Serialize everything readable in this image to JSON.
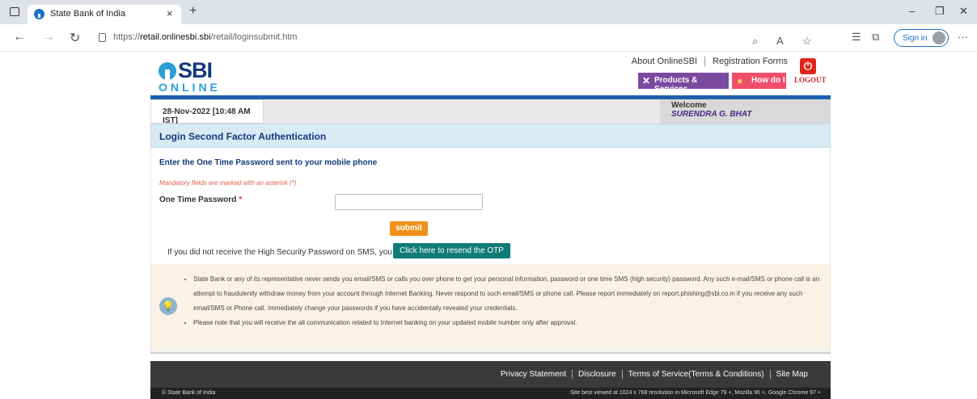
{
  "browser": {
    "tab_title": "State Bank of India",
    "tab_close": "×",
    "new_tab": "+",
    "url_prefix": "https://",
    "url_domain": "retail.onlinesbi.sbi",
    "url_path": "/retail/loginsubmit.htm",
    "sign_in": "Sign in",
    "minimize": "–",
    "maximize": "❐",
    "close": "✕",
    "back": "←",
    "forward": "→",
    "refresh": "↻",
    "more": "···"
  },
  "header": {
    "logo_text": "SBI",
    "logo_sub": "ONLINE",
    "about": "About OnlineSBI",
    "registration": "Registration Forms",
    "products": "Products & Services",
    "howdo": "How do I",
    "logout": "LOGOUT"
  },
  "infobar": {
    "date": "28-Nov-2022 [10:48 AM IST]",
    "welcome_label": "Welcome",
    "username": "SURENDRA G. BHAT"
  },
  "form": {
    "section_title": "Login Second Factor Authentication",
    "instruction": "Enter the One Time Password sent to your mobile phone",
    "mandatory_note": "Mandatory fields are marked with an asterisk (*)",
    "otp_label": "One Time Password",
    "asterisk": "*",
    "otp_value": "",
    "submit": "submit",
    "resend_text": "If you did not receive the High Security Password on SMS, you can",
    "resend_button": "Click here to resend the OTP"
  },
  "notice": {
    "items": [
      "State Bank or any of its representative never sends you email/SMS or calls you over phone to get your personal information, password or one time SMS (high security) password. Any such e-mail/SMS or phone call is an attempt to fraudulently withdraw money from your account through Internet Banking. Never respond to such email/SMS or phone call. Please report immediately on report.phishing@sbi.co.in if you receive any such email/SMS or Phone call. Immediately change your passwords if you have accidentally revealed your credentials.",
      "Please note that you will receive the all communication related to Internet banking on your updated mobile number only after approval."
    ]
  },
  "footer": {
    "privacy": "Privacy Statement",
    "disclosure": "Disclosure",
    "terms": "Terms of Service(Terms & Conditions)",
    "sitemap": "Site Map",
    "copyright": "© State Bank of India",
    "bestview": "Site best viewed at 1024 x 768 resolution in Microsoft Edge 79 +, Mozilla 96 +, Google Chrome 97 +"
  },
  "colors": {
    "brand_blue": "#1d5fb0",
    "products_purple": "#7b4aa0",
    "howdo_pink": "#ef4f6b",
    "submit_orange": "#f0921a",
    "resend_teal": "#0f7c78"
  }
}
